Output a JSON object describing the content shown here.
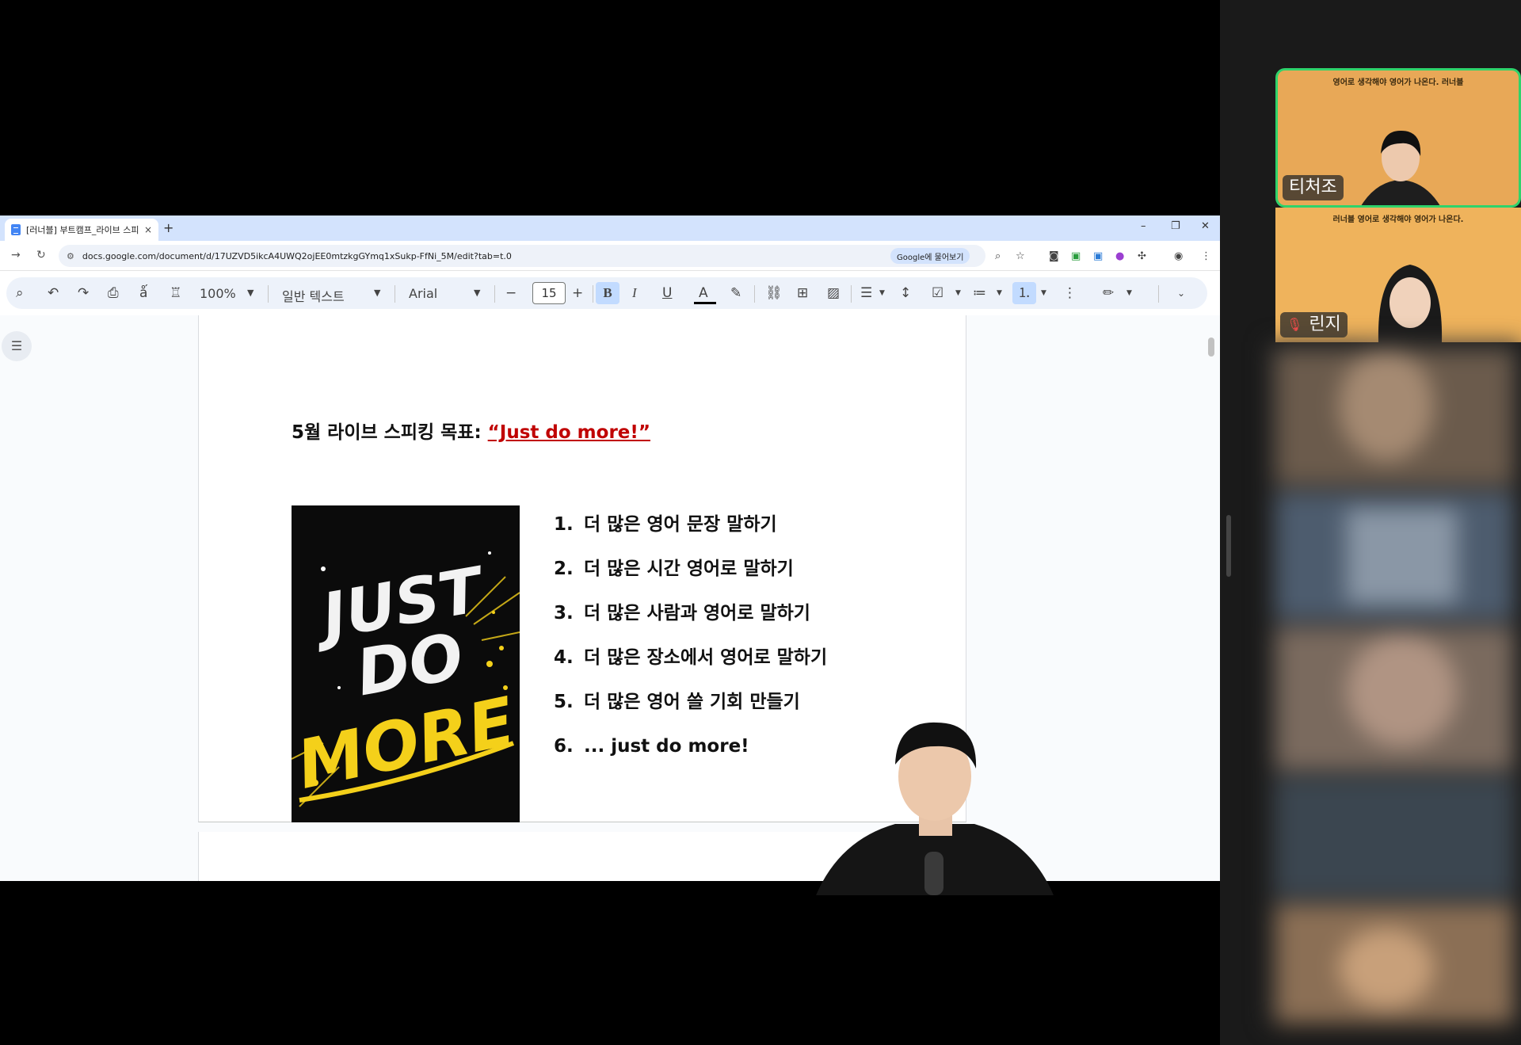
{
  "browser": {
    "tab_title": "[러너블] 부트캠프_라이브 스피",
    "tab_close": "×",
    "new_tab": "+",
    "url": "docs.google.com/document/d/17UZVD5ikcA4UWQ2ojEE0mtzkgGYmq1xSukp-FfNi_5M/edit?tab=t.0",
    "google_chip": "Google에 물어보기"
  },
  "toolbar": {
    "zoom": "100%",
    "style": "일반 텍스트",
    "font": "Arial",
    "font_size": "15",
    "bold": "B",
    "italic": "I",
    "underline": "U",
    "text_color": "A"
  },
  "document": {
    "goal_prefix": "5월 라이브 스피킹 목표: ",
    "goal_quote": "“Just do more!”",
    "poster": {
      "line1": "JUST",
      "line2": "DO",
      "line3": "MORE"
    },
    "list": [
      {
        "num": "1.",
        "text": "더 많은 영어 문장 말하기"
      },
      {
        "num": "2.",
        "text": "더 많은 시간 영어로 말하기"
      },
      {
        "num": "3.",
        "text": "더 많은 사람과 영어로 말하기"
      },
      {
        "num": "4.",
        "text": "더 많은 장소에서 영어로 말하기"
      },
      {
        "num": "5.",
        "text": "더 많은 영어 쓸 기회 만들기"
      },
      {
        "num": "6.",
        "text": "... just do more!"
      }
    ]
  },
  "participants": {
    "tile1": {
      "banner": "영어로 생각해야 영어가 나온다. 러너블",
      "name": "티처조"
    },
    "tile2": {
      "banner": "러너블 영어로 생각해야 영어가 나온다.",
      "name": "린지"
    }
  },
  "colors": {
    "accent_red": "#c00000",
    "speaker_border": "#2fd36b",
    "tile_bg": "#e8a857"
  }
}
